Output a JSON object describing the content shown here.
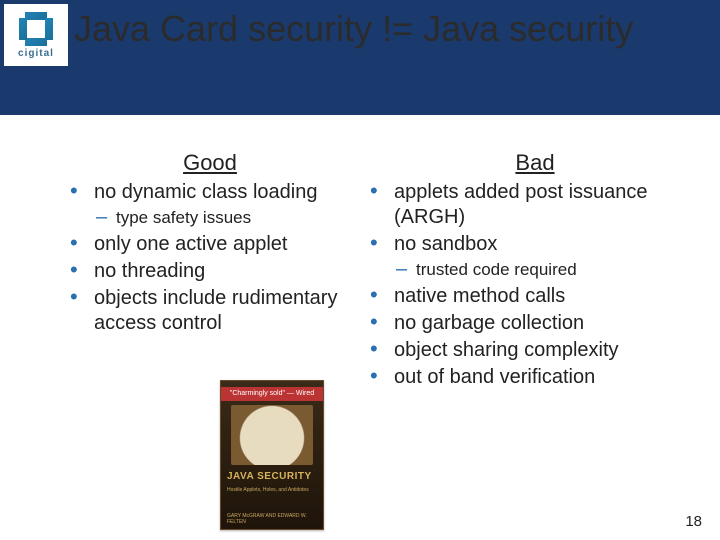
{
  "logo": {
    "text": "cigital"
  },
  "title": "Java Card security != Java security",
  "left": {
    "header": "Good",
    "items": [
      {
        "text": "no dynamic class loading",
        "sub": [
          "type safety issues"
        ]
      },
      {
        "text": "only one active applet"
      },
      {
        "text": "no threading"
      },
      {
        "text": "objects include rudimentary access control"
      }
    ]
  },
  "right": {
    "header": "Bad",
    "items": [
      {
        "text": "applets added post issuance (ARGH)"
      },
      {
        "text": "no sandbox",
        "sub": [
          "trusted code required"
        ]
      },
      {
        "text": "native method calls"
      },
      {
        "text": "no garbage collection"
      },
      {
        "text": "object sharing complexity"
      },
      {
        "text": "out of band verification"
      }
    ]
  },
  "book": {
    "title": "JAVA SECURITY",
    "subtitle": "Hostile Applets, Holes, and Antidotes",
    "authors": "GARY McGRAW AND EDWARD W. FELTEN"
  },
  "page": "18"
}
